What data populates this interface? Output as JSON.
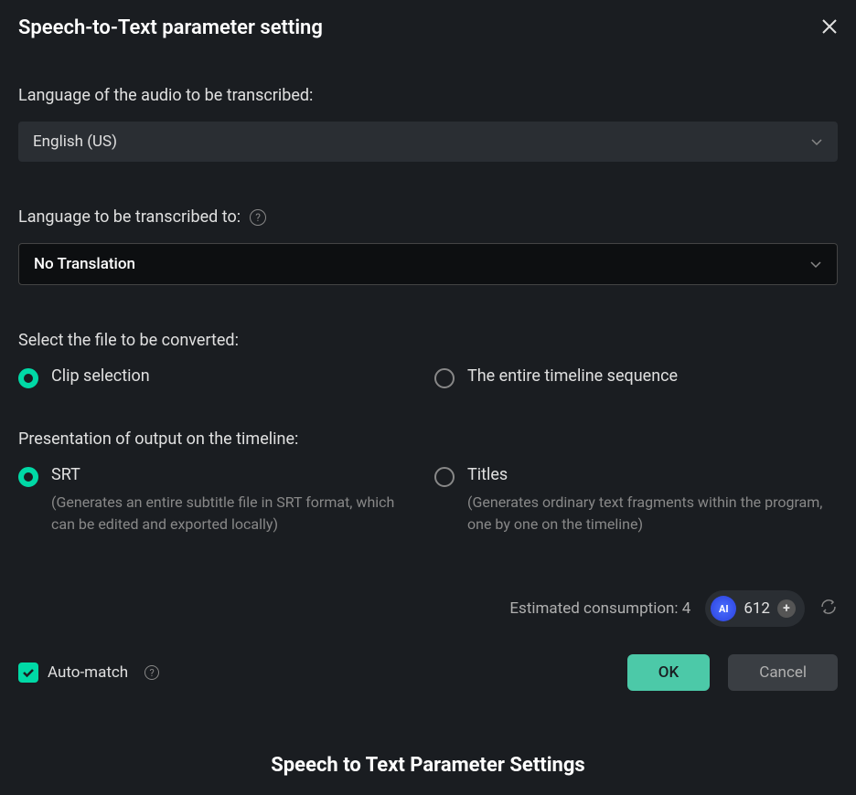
{
  "dialog": {
    "title": "Speech-to-Text parameter setting"
  },
  "sourceLanguage": {
    "label": "Language of the audio to be transcribed:",
    "value": "English (US)"
  },
  "targetLanguage": {
    "label": "Language to be transcribed to:",
    "value": "No Translation"
  },
  "fileSelection": {
    "label": "Select the file to be converted:",
    "options": {
      "clip": "Clip selection",
      "timeline": "The entire timeline sequence"
    },
    "selected": "clip"
  },
  "outputPresentation": {
    "label": "Presentation of output on the timeline:",
    "options": {
      "srt": {
        "label": "SRT",
        "description": "(Generates an entire subtitle file in SRT format, which can be edited and exported locally)"
      },
      "titles": {
        "label": "Titles",
        "description": "(Generates ordinary text fragments within the program, one by one on the timeline)"
      }
    },
    "selected": "srt"
  },
  "consumption": {
    "label": "Estimated consumption:",
    "value": "4",
    "credits": "612",
    "aiLabel": "AI"
  },
  "autoMatch": {
    "label": "Auto-match",
    "checked": true
  },
  "buttons": {
    "ok": "OK",
    "cancel": "Cancel"
  },
  "caption": "Speech to Text Parameter Settings"
}
